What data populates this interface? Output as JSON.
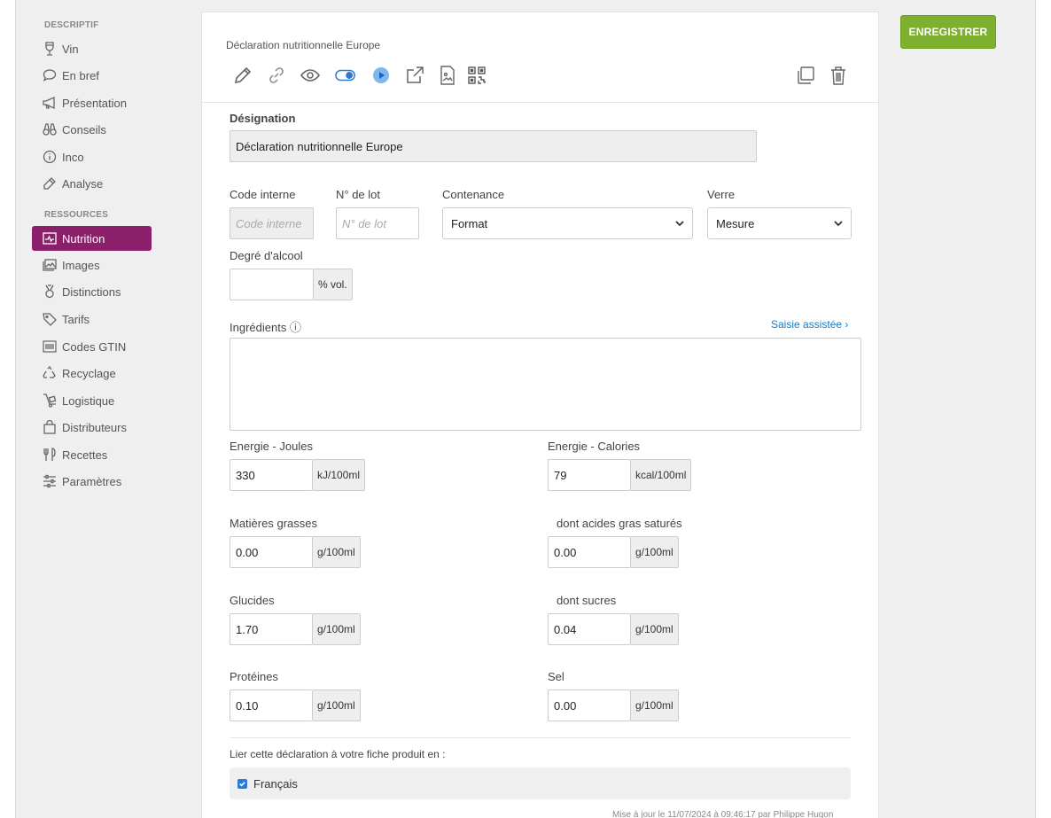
{
  "sidebar": {
    "section1": "DESCRIPTIF",
    "section2": "RESSOURCES",
    "items": [
      {
        "label": "Vin",
        "icon": "wine-glass-icon"
      },
      {
        "label": "En bref",
        "icon": "speech-bubble-icon"
      },
      {
        "label": "Présentation",
        "icon": "megaphone-icon"
      },
      {
        "label": "Conseils",
        "icon": "binoculars-icon"
      },
      {
        "label": "Inco",
        "icon": "info-circle-icon"
      },
      {
        "label": "Analyse",
        "icon": "pipette-icon"
      },
      {
        "label": "Nutrition",
        "icon": "pulse-chart-icon",
        "active": true
      },
      {
        "label": "Images",
        "icon": "images-icon"
      },
      {
        "label": "Distinctions",
        "icon": "medal-icon"
      },
      {
        "label": "Tarifs",
        "icon": "tag-icon"
      },
      {
        "label": "Codes GTIN",
        "icon": "barcode-icon"
      },
      {
        "label": "Recyclage",
        "icon": "recycle-icon"
      },
      {
        "label": "Logistique",
        "icon": "hand-truck-icon"
      },
      {
        "label": "Distributeurs",
        "icon": "shopping-bag-icon"
      },
      {
        "label": "Recettes",
        "icon": "utensils-icon"
      },
      {
        "label": "Paramètres",
        "icon": "sliders-icon"
      }
    ]
  },
  "card": {
    "title": "Déclaration nutritionnelle Europe"
  },
  "form": {
    "designation_label": "Désignation",
    "designation_value": "Déclaration nutritionnelle Europe",
    "code_label": "Code interne",
    "code_placeholder": "Code interne",
    "lot_label": "N° de lot",
    "lot_placeholder": "N° de lot",
    "contenance_label": "Contenance",
    "contenance_value": "Format",
    "verre_label": "Verre",
    "verre_value": "Mesure",
    "alcool_label": "Degré d'alcool",
    "alcool_value": "",
    "alcool_unit": "% vol.",
    "ingredients_label": "Ingrédients ⓘ",
    "assist_link": "Saisie assistée ›",
    "energie_j_label": "Energie - Joules",
    "energie_j_value": "330",
    "energie_j_unit": "kJ/100ml",
    "energie_c_label": "Energie - Calories",
    "energie_c_value": "79",
    "energie_c_unit": "kcal/100ml",
    "mg_label": "Matières grasses",
    "mg_value": "0.00",
    "ags_label": "dont acides gras saturés",
    "ags_value": "0.00",
    "glucides_label": "Glucides",
    "glucides_value": "1.70",
    "sucres_label": "dont sucres",
    "sucres_value": "0.04",
    "proteines_label": "Protéines",
    "proteines_value": "0.10",
    "sel_label": "Sel",
    "sel_value": "0.00",
    "unit_g": "g/100ml",
    "link_label": "Lier cette déclaration à votre fiche produit en :",
    "lang_option": "Français",
    "lang_checked": true,
    "updated_note": "Mise à jour le 11/07/2024 à 09:46:17 par Philippe Hugon"
  },
  "actions": {
    "save_label": "ENREGISTRER"
  },
  "colors": {
    "active_nav": "#8a1f6a",
    "save_button": "#7cb02e",
    "link": "#1a7bbf"
  }
}
